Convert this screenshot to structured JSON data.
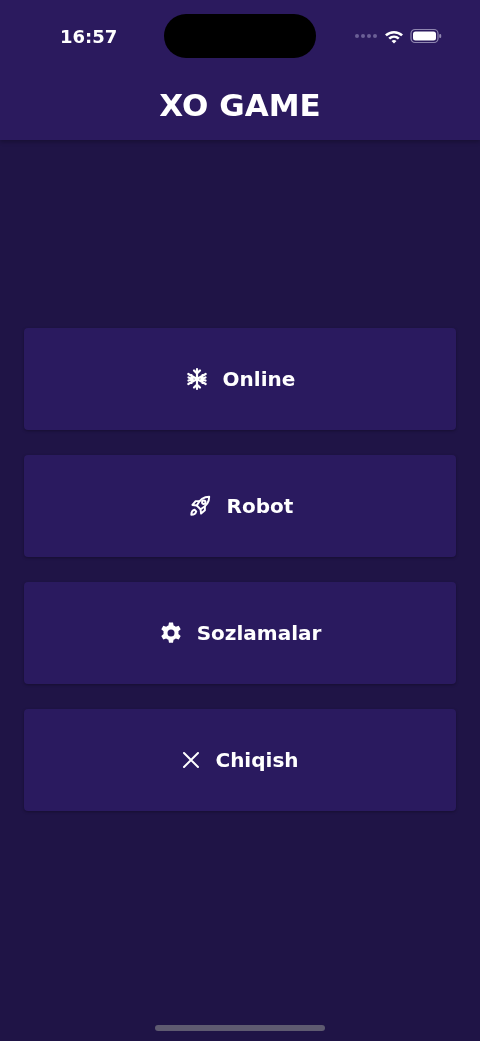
{
  "status_bar": {
    "time": "16:57"
  },
  "header": {
    "title": "XO GAME"
  },
  "menu": [
    {
      "label": "Online"
    },
    {
      "label": "Robot"
    },
    {
      "label": "Sozlamalar"
    },
    {
      "label": "Chiqish"
    }
  ]
}
